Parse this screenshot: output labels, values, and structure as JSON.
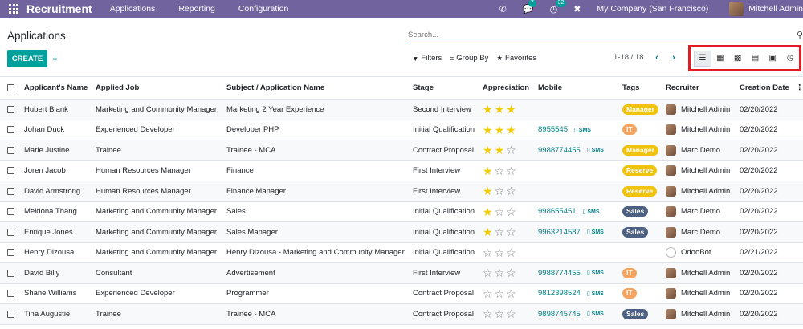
{
  "navbar": {
    "app_name": "Recruitment",
    "menu": [
      "Applications",
      "Reporting",
      "Configuration"
    ],
    "messages_badge": "7",
    "activities_badge": "32",
    "company": "My Company (San Francisco)",
    "user": "Mitchell Admin",
    "bg_color": "#71639e"
  },
  "control": {
    "title": "Applications",
    "search_placeholder": "Search...",
    "create_label": "CREATE",
    "filters_label": "Filters",
    "groupby_label": "Group By",
    "favorites_label": "Favorites",
    "pager": "1-18 / 18",
    "views": [
      "list",
      "kanban",
      "pivot",
      "graph",
      "calendar",
      "activity"
    ],
    "active_view": "list",
    "highlight_color": "#e31b23"
  },
  "columns": [
    "Applicant's Name",
    "Applied Job",
    "Subject / Application Name",
    "Stage",
    "Appreciation",
    "Mobile",
    "Tags",
    "Recruiter",
    "Creation Date"
  ],
  "tag_colors": {
    "Manager": "#f0c30e",
    "IT": "#f4a460",
    "Reserve": "#f0c30e",
    "Sales": "#4c6081"
  },
  "rows": [
    {
      "name": "Hubert Blank",
      "job": "Marketing and Community Manager",
      "subject": "Marketing 2 Year Experience",
      "stage": "Second Interview",
      "stars": 3,
      "mobile": "",
      "sms": "",
      "tag": "Manager",
      "recruiter": "Mitchell Admin",
      "bot": false,
      "date": "02/20/2022"
    },
    {
      "name": "Johan Duck",
      "job": "Experienced Developer",
      "subject": "Developer PHP",
      "stage": "Initial Qualification",
      "stars": 3,
      "mobile": "8955545",
      "sms": "SMS",
      "tag": "IT",
      "recruiter": "Mitchell Admin",
      "bot": false,
      "date": "02/20/2022"
    },
    {
      "name": "Marie Justine",
      "job": "Trainee",
      "subject": "Trainee - MCA",
      "stage": "Contract Proposal",
      "stars": 2,
      "mobile": "9988774455",
      "sms": "SMS",
      "tag": "Manager",
      "recruiter": "Marc Demo",
      "bot": false,
      "date": "02/20/2022"
    },
    {
      "name": "Joren Jacob",
      "job": "Human Resources Manager",
      "subject": "Finance",
      "stage": "First Interview",
      "stars": 1,
      "mobile": "",
      "sms": "",
      "tag": "Reserve",
      "recruiter": "Mitchell Admin",
      "bot": false,
      "date": "02/20/2022"
    },
    {
      "name": "David Armstrong",
      "job": "Human Resources Manager",
      "subject": "Finance Manager",
      "stage": "First Interview",
      "stars": 1,
      "mobile": "",
      "sms": "",
      "tag": "Reserve",
      "recruiter": "Mitchell Admin",
      "bot": false,
      "date": "02/20/2022"
    },
    {
      "name": "Meldona Thang",
      "job": "Marketing and Community Manager",
      "subject": "Sales",
      "stage": "Initial Qualification",
      "stars": 1,
      "mobile": "998655451",
      "sms": "SMS",
      "tag": "Sales",
      "recruiter": "Marc Demo",
      "bot": false,
      "date": "02/20/2022"
    },
    {
      "name": "Enrique Jones",
      "job": "Marketing and Community Manager",
      "subject": "Sales Manager",
      "stage": "Initial Qualification",
      "stars": 1,
      "mobile": "9963214587",
      "sms": "SMS",
      "tag": "Sales",
      "recruiter": "Marc Demo",
      "bot": false,
      "date": "02/20/2022"
    },
    {
      "name": "Henry Dizousa",
      "job": "Marketing and Community Manager",
      "subject": "Henry Dizousa - Marketing and Community Manager",
      "stage": "Initial Qualification",
      "stars": 0,
      "mobile": "",
      "sms": "",
      "tag": "",
      "recruiter": "OdooBot",
      "bot": true,
      "date": "02/21/2022"
    },
    {
      "name": "David Billy",
      "job": "Consultant",
      "subject": "Advertisement",
      "stage": "First Interview",
      "stars": 0,
      "mobile": "9988774455",
      "sms": "SMS",
      "tag": "IT",
      "recruiter": "Mitchell Admin",
      "bot": false,
      "date": "02/20/2022"
    },
    {
      "name": "Shane Williams",
      "job": "Experienced Developer",
      "subject": "Programmer",
      "stage": "Contract Proposal",
      "stars": 0,
      "mobile": "9812398524",
      "sms": "SMS",
      "tag": "IT",
      "recruiter": "Mitchell Admin",
      "bot": false,
      "date": "02/20/2022"
    },
    {
      "name": "Tina Augustie",
      "job": "Trainee",
      "subject": "Trainee - MCA",
      "stage": "Contract Proposal",
      "stars": 0,
      "mobile": "9898745745",
      "sms": "SMS",
      "tag": "Sales",
      "recruiter": "Mitchell Admin",
      "bot": false,
      "date": "02/20/2022"
    }
  ]
}
